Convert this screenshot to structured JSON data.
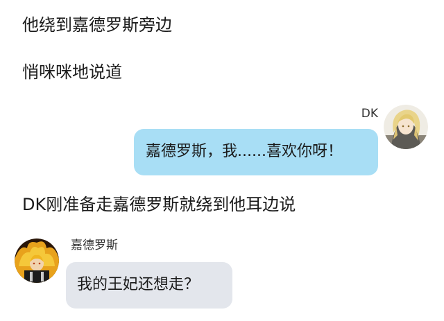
{
  "narration": [
    "他绕到嘉德罗斯旁边",
    "悄咪咪地说道",
    "DK刚准备走嘉德罗斯就绕到他耳边说"
  ],
  "messages": [
    {
      "sender": "DK",
      "side": "right",
      "text": "嘉德罗斯，我......喜欢你呀！",
      "bubble_color": "#a8def5",
      "avatar_icon": "blonde-character-avatar"
    },
    {
      "sender": "嘉德罗斯",
      "side": "left",
      "text": "我的王妃还想走？",
      "bubble_color": "#e3e6ec",
      "avatar_icon": "flame-hair-character-avatar"
    }
  ]
}
